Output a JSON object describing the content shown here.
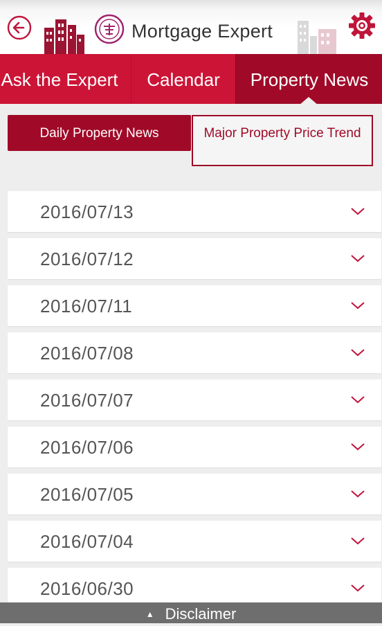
{
  "header": {
    "title": "Mortgage Expert",
    "back_icon": "back-arrow-icon",
    "logo_icon": "bank-seal-logo",
    "settings_icon": "gear-icon"
  },
  "tabs": [
    {
      "label": "Ask the Expert",
      "active": false
    },
    {
      "label": "Calendar",
      "active": false
    },
    {
      "label": "Property News",
      "active": true
    }
  ],
  "segments": {
    "daily": {
      "label": "Daily Property News",
      "active": true
    },
    "trend": {
      "label": "Major Property Price Trend",
      "active": false
    }
  },
  "dates": [
    "2016/07/13",
    "2016/07/12",
    "2016/07/11",
    "2016/07/08",
    "2016/07/07",
    "2016/07/06",
    "2016/07/05",
    "2016/07/04",
    "2016/06/30"
  ],
  "footer": {
    "label": "Disclaimer",
    "icon": "caret-up-icon"
  },
  "colors": {
    "brand_red": "#cc1436",
    "brand_dark_red": "#a00a28",
    "background": "#eeeeee",
    "footer_gray": "#6e6e6e"
  }
}
